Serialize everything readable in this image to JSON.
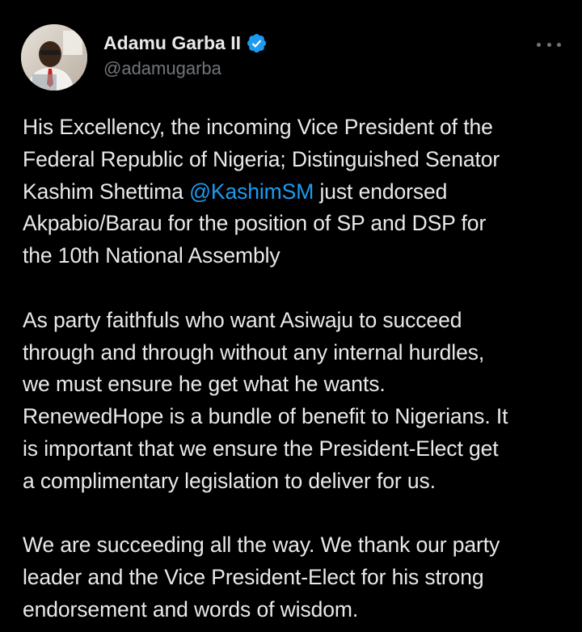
{
  "author": {
    "name": "Adamu Garba II",
    "handle": "@adamugarba",
    "verified_color": "#1d9bf0",
    "avatar_icon": "profile-photo"
  },
  "colors": {
    "background": "#000000",
    "text": "#e7e9ea",
    "secondary_text": "#71767b",
    "link": "#1d9bf0"
  },
  "tweet": {
    "paragraphs": [
      {
        "lines": [
          {
            "before": "His Excellency, the incoming Vice President of the"
          },
          {
            "before": "Federal Republic of Nigeria; Distinguished Senator"
          },
          {
            "before": "Kashim Shettima ",
            "mention": "@KashimSM",
            "after": " just endorsed"
          },
          {
            "before": "Akpabio/Barau for the position of SP and DSP for"
          },
          {
            "before": "the 10th National Assembly"
          }
        ]
      },
      {
        "lines": [
          {
            "before": "As party faithfuls who want Asiwaju to succeed"
          },
          {
            "before": "through and through without any internal hurdles,"
          },
          {
            "before": "we must ensure he get what he wants."
          },
          {
            "before": "RenewedHope is a bundle of benefit to Nigerians. It"
          },
          {
            "before": "is important that we ensure the President-Elect get"
          },
          {
            "before": "a complimentary legislation to deliver for us."
          }
        ]
      },
      {
        "lines": [
          {
            "before": "We are succeeding all the way. We thank our party"
          },
          {
            "before": "leader and the Vice President-Elect for his strong"
          },
          {
            "before": "endorsement and words of wisdom."
          }
        ]
      }
    ]
  }
}
